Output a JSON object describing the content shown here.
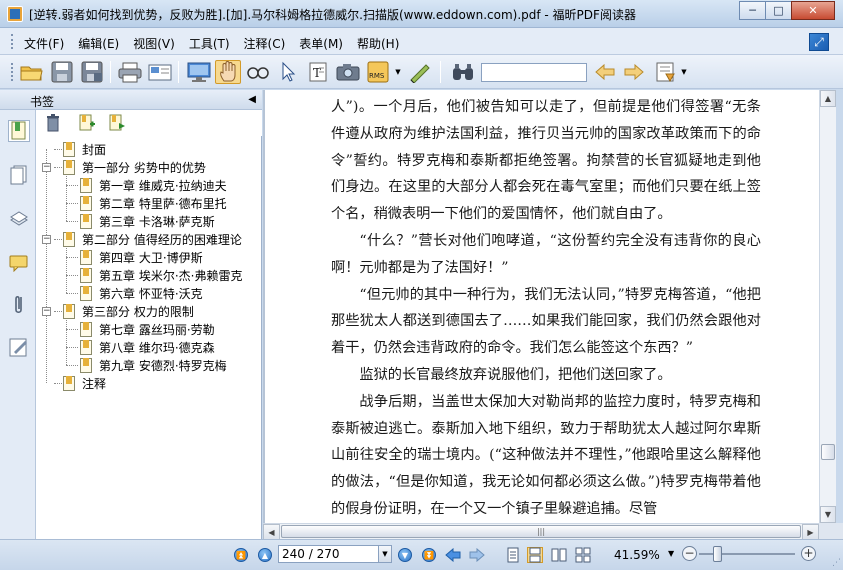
{
  "window": {
    "title": "[逆转.弱者如何找到优势，反败为胜].[加].马尔科姆格拉德威尔.扫描版(www.eddown.com).pdf - 福昕PDF阅读器",
    "minimize_glyph": "─",
    "maximize_glyph": "□",
    "close_glyph": "✕"
  },
  "menu": {
    "items": [
      "文件(F)",
      "编辑(E)",
      "视图(V)",
      "工具(T)",
      "注释(C)",
      "表单(M)",
      "帮助(H)"
    ]
  },
  "toolbar": {
    "search_value": "",
    "icons": [
      "open-folder",
      "save",
      "save-as",
      "print",
      "email",
      "full-screen",
      "hand-tool",
      "zoom-tool",
      "select-tool",
      "text-select",
      "snapshot",
      "rms",
      "sign",
      "find",
      "prev-result",
      "next-result",
      "stamp"
    ]
  },
  "panel": {
    "title": "书签",
    "collapse_glyph": "◀"
  },
  "bookmarks": [
    {
      "label": "封面",
      "level": 0,
      "expander": ""
    },
    {
      "label": "第一部分 劣势中的优势",
      "level": 0,
      "expander": "−"
    },
    {
      "label": "第一章 维威克·拉纳迪夫",
      "level": 1,
      "expander": ""
    },
    {
      "label": "第二章 特里萨·德布里托",
      "level": 1,
      "expander": ""
    },
    {
      "label": "第三章 卡洛琳·萨克斯",
      "level": 1,
      "expander": ""
    },
    {
      "label": "第二部分 值得经历的困难理论",
      "level": 0,
      "expander": "−"
    },
    {
      "label": "第四章 大卫·博伊斯",
      "level": 1,
      "expander": ""
    },
    {
      "label": "第五章 埃米尔·杰·弗赖雷克",
      "level": 1,
      "expander": ""
    },
    {
      "label": "第六章 怀亚特·沃克",
      "level": 1,
      "expander": ""
    },
    {
      "label": "第三部分 权力的限制",
      "level": 0,
      "expander": "−"
    },
    {
      "label": "第七章 露丝玛丽·劳勒",
      "level": 1,
      "expander": ""
    },
    {
      "label": "第八章 维尔玛·德克森",
      "level": 1,
      "expander": ""
    },
    {
      "label": "第九章 安德烈·特罗克梅",
      "level": 1,
      "expander": ""
    },
    {
      "label": "注释",
      "level": 0,
      "expander": ""
    }
  ],
  "document": {
    "paragraphs": [
      {
        "indent": false,
        "text": "人”)。一个月后，他们被告知可以走了，但前提是他们得签署“无条件遵从政府为维护法国利益，推行贝当元帅的国家改革政策而下的命令”誓约。特罗克梅和泰斯都拒绝签署。拘禁营的长官狐疑地走到他们身边。在这里的大部分人都会死在毒气室里；而他们只要在纸上签个名，稍微表明一下他们的爱国情怀，他们就自由了。"
      },
      {
        "indent": true,
        "text": "“什么？”营长对他们咆哮道，“这份誓约完全没有违背你的良心啊！元帅都是为了法国好！”"
      },
      {
        "indent": true,
        "text": "“但元帅的其中一种行为，我们无法认同，”特罗克梅答道，“他把那些犹太人都送到德国去了……如果我们能回家，我们仍然会跟他对着干，仍然会违背政府的命令。我们怎么能签这个东西？”"
      },
      {
        "indent": true,
        "text": "监狱的长官最终放弃说服他们，把他们送回家了。"
      },
      {
        "indent": true,
        "text": "战争后期，当盖世太保加大对勒尚邦的监控力度时，特罗克梅和泰斯被迫逃亡。泰斯加入地下组织，致力于帮助犹太人越过阿尔卑斯山前往安全的瑞士境内。(“这种做法并不理性，”他跟哈里这么解释他的做法，“但是你知道，我无论如何都必须这么做。”)特罗克梅带着他的假身份证明，在一个又一个镇子里躲避追捕。尽管"
      }
    ]
  },
  "status": {
    "page_value": "240 / 270",
    "zoom_value": "41.59%"
  }
}
